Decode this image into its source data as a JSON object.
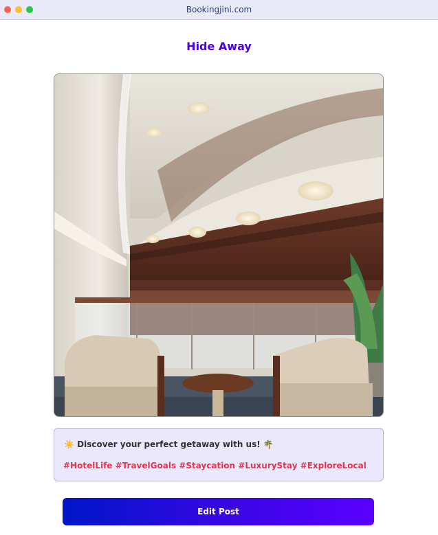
{
  "window": {
    "title": "Bookingjini.com",
    "controls": [
      "close",
      "minimize",
      "maximize"
    ]
  },
  "post": {
    "title": "Hide Away",
    "image_description_icon": "hotel-atrium-image",
    "caption_emoji_start": "☀️",
    "caption_text": "Discover your perfect getaway with us!",
    "caption_emoji_end": "🌴",
    "hashtags": "#HotelLife #TravelGoals #Staycation #LuxuryStay #ExploreLocal"
  },
  "actions": {
    "edit_label": "Edit Post"
  },
  "colors": {
    "title": "#4d00e6",
    "hashtags": "#e8334d",
    "button_gradient_start": "#0016c8",
    "button_gradient_end": "#5a00ff",
    "caption_background": "#ebe8fd"
  }
}
